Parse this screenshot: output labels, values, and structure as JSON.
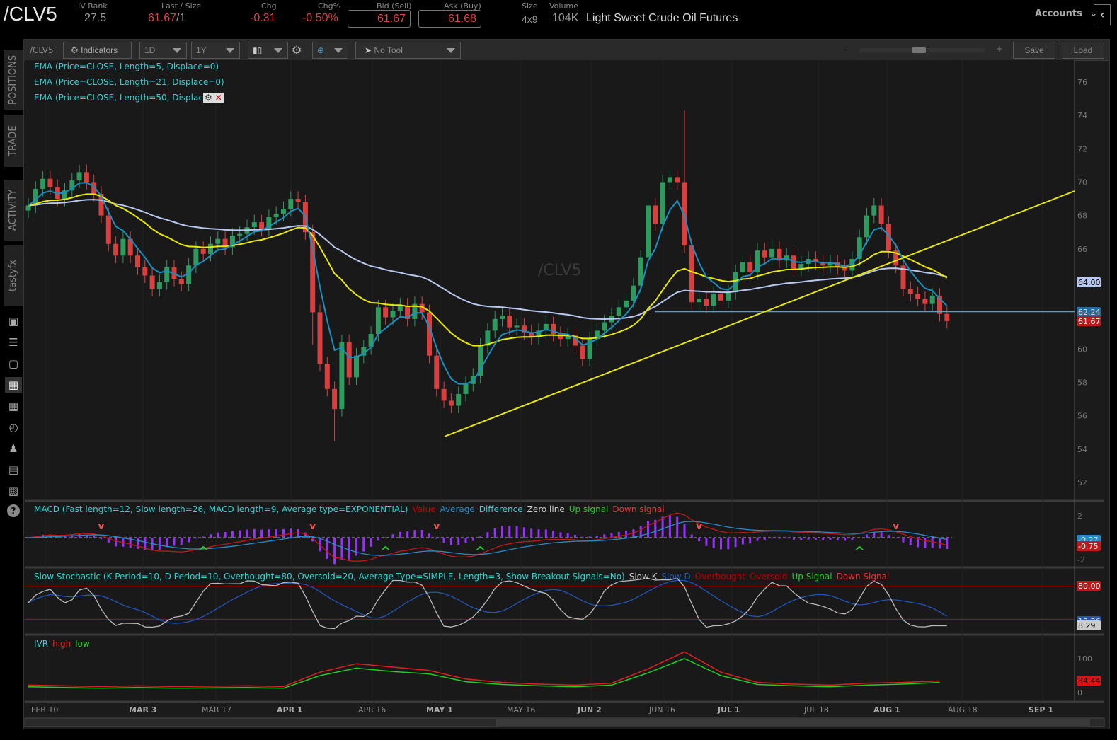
{
  "header": {
    "symbol": "/CLV5",
    "iv_rank_label": "IV Rank",
    "iv_rank": "27.5",
    "last_label": "Last / Size",
    "last": "61.67",
    "size": "/1",
    "chg_label": "Chg",
    "chg": "-0.31",
    "chgpct_label": "Chg%",
    "chgpct": "-0.50%",
    "bid_label": "Bid (Sell)",
    "bid": "61.67",
    "ask_label": "Ask (Buy)",
    "ask": "61.68",
    "size_label": "Size",
    "size_val": "4x9",
    "volume_label": "Volume",
    "volume": "104K",
    "description": "Light Sweet Crude Oil Futures",
    "accounts": "Accounts"
  },
  "sidebar": {
    "tabs": [
      "POSITIONS",
      "TRADE",
      "ACTIVITY",
      "tastyfx"
    ],
    "icons": [
      "watchlist-icon",
      "list-icon",
      "tv-icon",
      "chart-icon",
      "grid-icon",
      "dashboard-icon",
      "community-icon",
      "calendar-icon",
      "fx-icon",
      "help-icon"
    ],
    "selected_icon": "chart-icon"
  },
  "toolbar": {
    "symbol": "/CLV5",
    "indicators": "Indicators",
    "interval": "1D",
    "range": "1Y",
    "tool": "No Tool",
    "zoom_minus": "-",
    "zoom_plus": "+",
    "save": "Save",
    "load": "Load",
    "zoom_level": 0.47
  },
  "legend": {
    "ema": [
      "EMA (Price=CLOSE, Length=5, Displace=0)",
      "EMA (Price=CLOSE, Length=21, Displace=0)",
      "EMA (Price=CLOSE, Length=50, Displac"
    ],
    "macd": {
      "title": "MACD (Fast length=12, Slow length=26, MACD length=9, Average type=EXPONENTIAL)",
      "items": [
        "Value",
        "Average",
        "Difference",
        "Zero line",
        "Up signal",
        "Down signal"
      ]
    },
    "stoch": {
      "title": "Slow Stochastic (K Period=10, D Period=10, Overbought=80, Oversold=20, Average Type=SIMPLE, Length=3, Show Breakout Signals=No)",
      "items": [
        "Slow K",
        "Slow D",
        "Overbought",
        "Oversold",
        "Up Signal",
        "Down Signal"
      ]
    },
    "ivr": {
      "title": "IVR",
      "items": [
        "high",
        "low"
      ]
    }
  },
  "colors": {
    "up": "#2e9a5e",
    "down": "#d84040",
    "ema5": "#1a8fc0",
    "ema21": "#e8e800",
    "ema50": "#b8c8f0",
    "legend": "#2ad4d4",
    "histogram": "#9a30ff"
  },
  "watermark": "/CLV5",
  "chart_data": {
    "type": "candlestick",
    "ylim": [
      51,
      77
    ],
    "price_ticks": [
      "76",
      "74",
      "72",
      "70",
      "68",
      "66",
      "64",
      "62",
      "60",
      "58",
      "56",
      "54",
      "52"
    ],
    "date_ticks": [
      {
        "label": "FEB 10",
        "bold": false
      },
      {
        "label": "MAR 3",
        "bold": true
      },
      {
        "label": "MAR 17",
        "bold": false
      },
      {
        "label": "APR 1",
        "bold": true
      },
      {
        "label": "APR 16",
        "bold": false
      },
      {
        "label": "MAY 1",
        "bold": true
      },
      {
        "label": "MAY 16",
        "bold": false
      },
      {
        "label": "JUN 2",
        "bold": true
      },
      {
        "label": "JUN 16",
        "bold": false
      },
      {
        "label": "JUL 1",
        "bold": true
      },
      {
        "label": "JUL 18",
        "bold": false
      },
      {
        "label": "AUG 1",
        "bold": true
      },
      {
        "label": "AUG 18",
        "bold": false
      },
      {
        "label": "SEP 1",
        "bold": true
      }
    ],
    "closes": [
      68.6,
      69.6,
      70.2,
      69.7,
      69.0,
      69.5,
      70.1,
      70.6,
      70.0,
      69.3,
      68.0,
      66.3,
      65.6,
      66.6,
      65.6,
      64.9,
      64.4,
      63.6,
      64.0,
      64.9,
      64.2,
      63.9,
      65.0,
      66.0,
      65.7,
      66.3,
      66.6,
      66.1,
      66.8,
      66.9,
      67.3,
      67.6,
      67.2,
      67.9,
      68.1,
      68.4,
      69.0,
      68.8,
      67.0,
      62.2,
      59.1,
      57.6,
      56.4,
      60.4,
      58.3,
      59.6,
      60.1,
      60.9,
      62.5,
      61.9,
      62.3,
      62.6,
      61.8,
      62.7,
      62.2,
      59.6,
      57.6,
      56.9,
      56.6,
      57.3,
      57.9,
      58.4,
      60.2,
      61.1,
      61.8,
      62.0,
      61.3,
      61.4,
      61.0,
      60.7,
      61.1,
      61.5,
      60.9,
      60.6,
      60.8,
      60.2,
      59.4,
      60.6,
      61.1,
      61.6,
      62.0,
      62.5,
      62.9,
      63.8,
      65.5,
      68.6,
      67.5,
      70.0,
      70.3,
      70.0,
      66.2,
      62.8,
      63.0,
      62.6,
      63.3,
      62.9,
      63.4,
      64.6,
      65.2,
      64.6,
      65.9,
      65.5,
      66.0,
      65.3,
      65.6,
      64.8,
      65.1,
      65.4,
      65.2,
      65.0,
      65.2,
      64.9,
      64.7,
      65.4,
      66.7,
      68.0,
      68.6,
      67.5,
      65.9,
      65.0,
      63.6,
      63.3,
      63.0,
      62.7,
      63.2,
      62.1,
      61.67
    ],
    "spike_high": {
      "date": "JUN 20",
      "high": 74.3
    },
    "horizontal_line": 62.24,
    "trendline": [
      {
        "date": "MAY 5",
        "price": 54.8
      },
      {
        "date": "SEP 5",
        "price": 69.5
      }
    ],
    "axis_labels": {
      "ema50": "64.00",
      "hline": "62.24",
      "last": "61.67"
    },
    "macd": {
      "ticks": [
        "2",
        "-2"
      ],
      "labels": [
        "-0.27",
        "-0.75"
      ]
    },
    "stoch": {
      "ticks": [
        "80.00"
      ],
      "overbought": 80,
      "oversold": 20,
      "labels": [
        "18.36",
        "8.29"
      ]
    },
    "ivr": {
      "ticks": [
        "100",
        "0"
      ],
      "label": "34.44",
      "high": [
        22,
        20,
        18,
        20,
        18,
        19,
        20,
        18,
        60,
        85,
        75,
        65,
        40,
        30,
        25,
        22,
        28,
        70,
        120,
        60,
        30,
        25,
        22,
        28,
        30,
        34.44
      ],
      "low": [
        17,
        15,
        13,
        15,
        13,
        14,
        15,
        13,
        50,
        72,
        62,
        55,
        32,
        24,
        20,
        17,
        22,
        58,
        100,
        50,
        24,
        20,
        17,
        22,
        25,
        30
      ]
    }
  }
}
